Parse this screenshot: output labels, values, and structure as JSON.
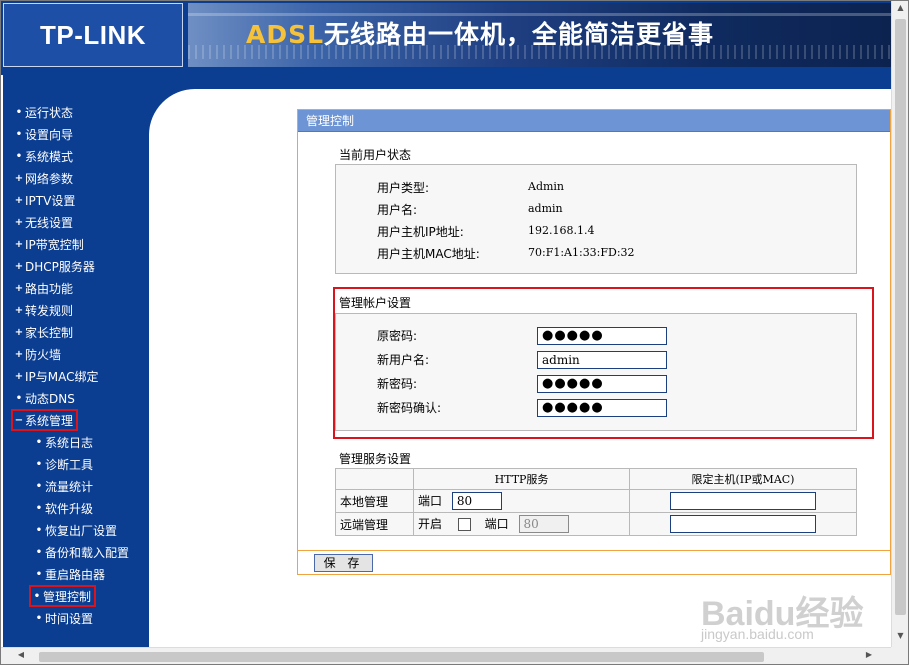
{
  "header": {
    "logo": "TP-LINK",
    "banner_part1": "ADSL",
    "banner_part2": "无线路由一体机，全能简洁更省事"
  },
  "sidebar": {
    "items": [
      {
        "mark": "•",
        "label": "运行状态"
      },
      {
        "mark": "•",
        "label": "设置向导"
      },
      {
        "mark": "•",
        "label": "系统模式"
      },
      {
        "mark": "+",
        "label": "网络参数"
      },
      {
        "mark": "+",
        "label": "IPTV设置"
      },
      {
        "mark": "+",
        "label": "无线设置"
      },
      {
        "mark": "+",
        "label": "IP带宽控制"
      },
      {
        "mark": "+",
        "label": "DHCP服务器"
      },
      {
        "mark": "+",
        "label": "路由功能"
      },
      {
        "mark": "+",
        "label": "转发规则"
      },
      {
        "mark": "+",
        "label": "家长控制"
      },
      {
        "mark": "+",
        "label": "防火墙"
      },
      {
        "mark": "+",
        "label": "IP与MAC绑定"
      },
      {
        "mark": "•",
        "label": "动态DNS"
      },
      {
        "mark": "−",
        "label": "系统管理"
      }
    ],
    "subitems": [
      {
        "mark": "•",
        "label": "系统日志"
      },
      {
        "mark": "•",
        "label": "诊断工具"
      },
      {
        "mark": "•",
        "label": "流量统计"
      },
      {
        "mark": "•",
        "label": "软件升级"
      },
      {
        "mark": "•",
        "label": "恢复出厂设置"
      },
      {
        "mark": "•",
        "label": "备份和载入配置"
      },
      {
        "mark": "•",
        "label": "重启路由器"
      },
      {
        "mark": "•",
        "label": "管理控制"
      },
      {
        "mark": "•",
        "label": "时间设置"
      }
    ]
  },
  "panel": {
    "title": "管理控制",
    "user_status": {
      "title": "当前用户状态",
      "rows": [
        {
          "label": "用户类型:",
          "value": "Admin"
        },
        {
          "label": "用户名:",
          "value": "admin"
        },
        {
          "label": "用户主机IP地址:",
          "value": "192.168.1.4"
        },
        {
          "label": "用户主机MAC地址:",
          "value": "70:F1:A1:33:FD:32"
        }
      ]
    },
    "account": {
      "title": "管理帐户设置",
      "old_pw_label": "原密码:",
      "old_pw_value": "●●●●●",
      "new_user_label": "新用户名:",
      "new_user_value": "admin",
      "new_pw_label": "新密码:",
      "new_pw_value": "●●●●●",
      "confirm_pw_label": "新密码确认:",
      "confirm_pw_value": "●●●●●"
    },
    "service": {
      "title": "管理服务设置",
      "col_http": "HTTP服务",
      "col_host": "限定主机(IP或MAC)",
      "local_label": "本地管理",
      "remote_label": "远端管理",
      "port_label": "端口",
      "enable_label": "开启",
      "local_port": "80",
      "remote_port": "80",
      "local_host": "",
      "remote_host": ""
    },
    "save_button": "保 存"
  },
  "watermark": {
    "main": "Baidu经验",
    "sub": "jingyan.baidu.com"
  }
}
